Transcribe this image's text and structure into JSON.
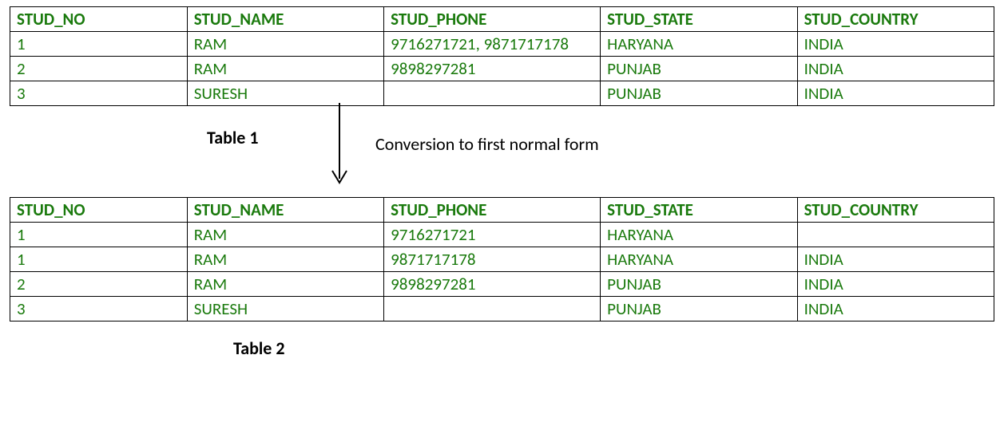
{
  "table1": {
    "label": "Table 1",
    "headers": {
      "stud_no": "STUD_NO",
      "stud_name": "STUD_NAME",
      "stud_phone": "STUD_PHONE",
      "stud_state": "STUD_STATE",
      "stud_country": "STUD_COUNTRY"
    },
    "rows": [
      {
        "stud_no": "1",
        "stud_name": "RAM",
        "stud_phone": "9716271721, 9871717178",
        "stud_state": "HARYANA",
        "stud_country": "INDIA"
      },
      {
        "stud_no": "2",
        "stud_name": "RAM",
        "stud_phone": "9898297281",
        "stud_state": "PUNJAB",
        "stud_country": "INDIA"
      },
      {
        "stud_no": "3",
        "stud_name": "SURESH",
        "stud_phone": "",
        "stud_state": "PUNJAB",
        "stud_country": "INDIA"
      }
    ]
  },
  "conversion_label": "Conversion to first normal form",
  "table2": {
    "label": "Table 2",
    "headers": {
      "stud_no": "STUD_NO",
      "stud_name": "STUD_NAME",
      "stud_phone": "STUD_PHONE",
      "stud_state": "STUD_STATE",
      "stud_country": "STUD_COUNTRY"
    },
    "rows": [
      {
        "stud_no": "1",
        "stud_name": "RAM",
        "stud_phone": "9716271721",
        "stud_state": "HARYANA",
        "stud_country": ""
      },
      {
        "stud_no": "1",
        "stud_name": "RAM",
        "stud_phone": "9871717178",
        "stud_state": "HARYANA",
        "stud_country": "INDIA"
      },
      {
        "stud_no": "2",
        "stud_name": "RAM",
        "stud_phone": "9898297281",
        "stud_state": "PUNJAB",
        "stud_country": "INDIA"
      },
      {
        "stud_no": "3",
        "stud_name": "SURESH",
        "stud_phone": "",
        "stud_state": "PUNJAB",
        "stud_country": "INDIA"
      }
    ]
  }
}
